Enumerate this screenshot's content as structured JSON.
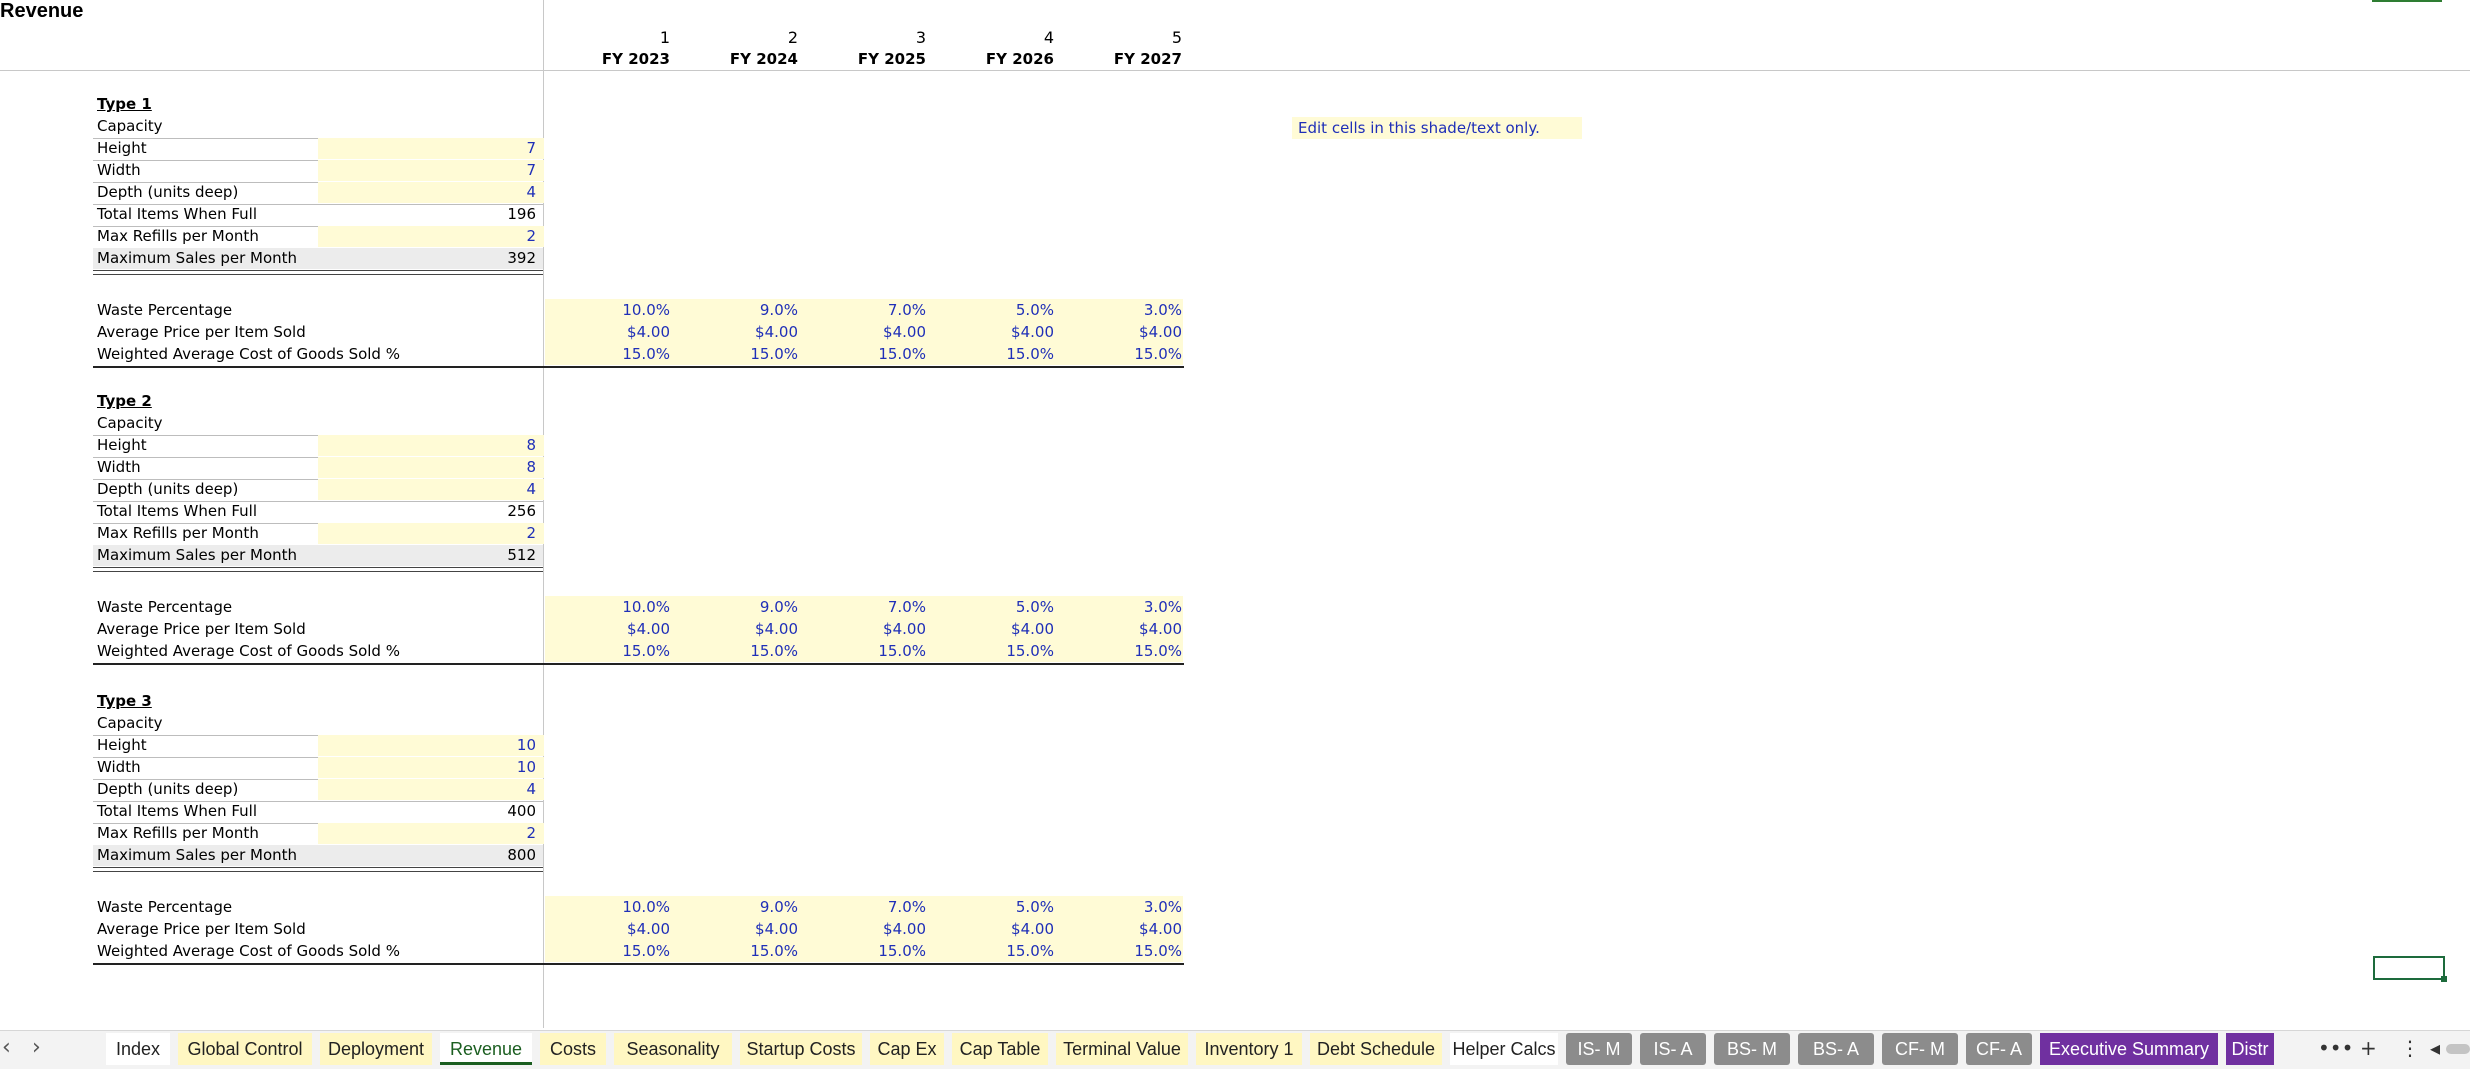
{
  "sheet": {
    "title": "Revenue"
  },
  "periods": [
    {
      "num": "1",
      "fy": "FY 2023"
    },
    {
      "num": "2",
      "fy": "FY 2024"
    },
    {
      "num": "3",
      "fy": "FY 2025"
    },
    {
      "num": "4",
      "fy": "FY 2026"
    },
    {
      "num": "5",
      "fy": "FY 2027"
    }
  ],
  "note": "Edit cells in this shade/text only.",
  "labels": {
    "capacity": "Capacity",
    "height": "Height",
    "width": "Width",
    "depth": "Depth (units deep)",
    "total": "Total Items When Full",
    "refills": "Max Refills per Month",
    "max_sales": "Maximum Sales per Month",
    "waste": "Waste Percentage",
    "price": "Average Price per Item Sold",
    "cogs": "Weighted Average Cost of Goods Sold %"
  },
  "types": [
    {
      "name": "Type 1",
      "height": "7",
      "width": "7",
      "depth": "4",
      "total": "196",
      "refills": "2",
      "max_sales": "392",
      "waste": [
        "10.0%",
        "9.0%",
        "7.0%",
        "5.0%",
        "3.0%"
      ],
      "price": [
        "$4.00",
        "$4.00",
        "$4.00",
        "$4.00",
        "$4.00"
      ],
      "cogs": [
        "15.0%",
        "15.0%",
        "15.0%",
        "15.0%",
        "15.0%"
      ]
    },
    {
      "name": "Type 2",
      "height": "8",
      "width": "8",
      "depth": "4",
      "total": "256",
      "refills": "2",
      "max_sales": "512",
      "waste": [
        "10.0%",
        "9.0%",
        "7.0%",
        "5.0%",
        "3.0%"
      ],
      "price": [
        "$4.00",
        "$4.00",
        "$4.00",
        "$4.00",
        "$4.00"
      ],
      "cogs": [
        "15.0%",
        "15.0%",
        "15.0%",
        "15.0%",
        "15.0%"
      ]
    },
    {
      "name": "Type 3",
      "height": "10",
      "width": "10",
      "depth": "4",
      "total": "400",
      "refills": "2",
      "max_sales": "800",
      "waste": [
        "10.0%",
        "9.0%",
        "7.0%",
        "5.0%",
        "3.0%"
      ],
      "price": [
        "$4.00",
        "$4.00",
        "$4.00",
        "$4.00",
        "$4.00"
      ],
      "cogs": [
        "15.0%",
        "15.0%",
        "15.0%",
        "15.0%",
        "15.0%"
      ]
    }
  ],
  "tabs": [
    {
      "label": "Index",
      "style": "w"
    },
    {
      "label": "Global Control",
      "style": "y"
    },
    {
      "label": "Deployment",
      "style": "y"
    },
    {
      "label": "Revenue",
      "style": "active"
    },
    {
      "label": "Costs",
      "style": "y"
    },
    {
      "label": "Seasonality",
      "style": "y"
    },
    {
      "label": "Startup Costs",
      "style": "y"
    },
    {
      "label": "Cap Ex",
      "style": "y"
    },
    {
      "label": "Cap Table",
      "style": "y"
    },
    {
      "label": "Terminal Value",
      "style": "y"
    },
    {
      "label": "Inventory 1",
      "style": "y"
    },
    {
      "label": "Debt Schedule",
      "style": "y"
    },
    {
      "label": "Helper Calcs",
      "style": "w"
    },
    {
      "label": "IS- M",
      "style": "g"
    },
    {
      "label": "IS- A",
      "style": "g"
    },
    {
      "label": "BS- M",
      "style": "g"
    },
    {
      "label": "BS- A",
      "style": "g"
    },
    {
      "label": "CF- M",
      "style": "g"
    },
    {
      "label": "CF- A",
      "style": "g"
    },
    {
      "label": "Executive Summary",
      "style": "p"
    },
    {
      "label": "Distr",
      "style": "p"
    }
  ],
  "tabbar_controls": {
    "prev": "‹",
    "next": "›",
    "more": "•••",
    "add": "+",
    "options": "⋮",
    "scroll_left": "◂"
  }
}
